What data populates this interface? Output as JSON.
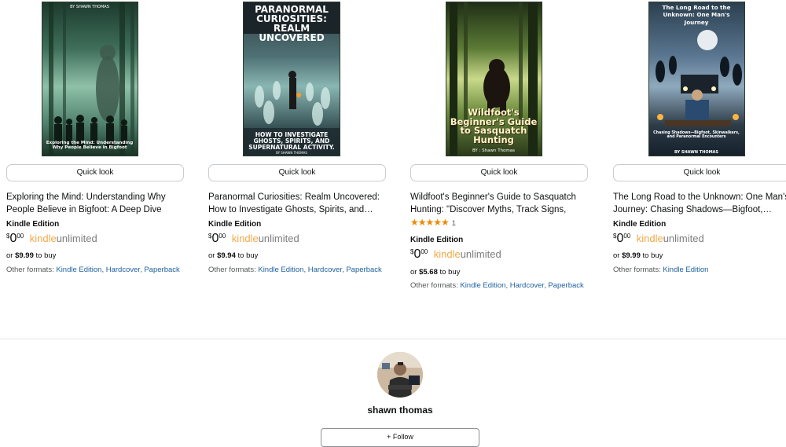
{
  "books": [
    {
      "cover_title": "Exploring the Mind: Understanding Why People Believe in Bigfoot",
      "cover_author": "BY SHAWN THOMAS",
      "quick_look": "Quick look",
      "title": "Exploring the Mind: Understanding Why People Believe in Bigfoot: A Deep Dive into…",
      "edition": "Kindle Edition",
      "price_dollar": "$",
      "price_main": "0",
      "price_cents": "00",
      "ku_kindle": "kindle",
      "ku_unlimited": "unlimited",
      "or_prefix": "or",
      "buy_price": "$9.99",
      "buy_suffix": "to buy",
      "formats_label": "Other formats:",
      "formats": [
        "Kindle Edition",
        "Hardcover",
        "Paperback"
      ]
    },
    {
      "cover_title": "PARANORMAL CURIOSITIES: REALM UNCOVERED",
      "cover_subtitle": "HOW TO INVESTIGATE GHOSTS, SPIRITS, AND SUPERNATURAL ACTIVITY.",
      "cover_author": "BY SHAWN THOMAS",
      "quick_look": "Quick look",
      "title": "Paranormal Curiosities: Realm Uncovered: How to Investigate Ghosts, Spirits, and…",
      "edition": "Kindle Edition",
      "price_dollar": "$",
      "price_main": "0",
      "price_cents": "00",
      "ku_kindle": "kindle",
      "ku_unlimited": "unlimited",
      "or_prefix": "or",
      "buy_price": "$9.94",
      "buy_suffix": "to buy",
      "formats_label": "Other formats:",
      "formats": [
        "Kindle Edition",
        "Hardcover",
        "Paperback"
      ]
    },
    {
      "cover_title": "Wildfoot's Beginner's Guide to Sasquatch Hunting",
      "cover_author": "BY : Shawn Thomas",
      "quick_look": "Quick look",
      "title": "Wildfoot's Beginner's Guide to Sasquatch Hunting: \"Discover Myths, Track Signs, and…",
      "rating": 5,
      "rating_stars": "★★★★★",
      "rating_count": "1",
      "edition": "Kindle Edition",
      "price_dollar": "$",
      "price_main": "0",
      "price_cents": "00",
      "ku_kindle": "kindle",
      "ku_unlimited": "unlimited",
      "or_prefix": "or",
      "buy_price": "$5.68",
      "buy_suffix": "to buy",
      "formats_label": "Other formats:",
      "formats": [
        "Kindle Edition",
        "Hardcover",
        "Paperback"
      ]
    },
    {
      "cover_title": "The Long Road to the Unknown: One Man's Journey",
      "cover_subtitle": "Chasing Shadows—Bigfoot, Skinwalkers, and Paranormal Encounters",
      "cover_author": "BY SHAWN THOMAS",
      "quick_look": "Quick look",
      "title": "The Long Road to the Unknown: One Man's Journey: Chasing Shadows—Bigfoot,…",
      "edition": "Kindle Edition",
      "price_dollar": "$",
      "price_main": "0",
      "price_cents": "00",
      "ku_kindle": "kindle",
      "ku_unlimited": "unlimited",
      "or_prefix": "or",
      "buy_price": "$9.99",
      "buy_suffix": "to buy",
      "formats_label": "Other formats:",
      "formats": [
        "Kindle Edition"
      ]
    }
  ],
  "author": {
    "name": "shawn thomas",
    "follow_label": "+ Follow"
  },
  "colors": {
    "link": "#2162a1",
    "kindle_orange": "#f3a847",
    "star": "#f08804"
  }
}
